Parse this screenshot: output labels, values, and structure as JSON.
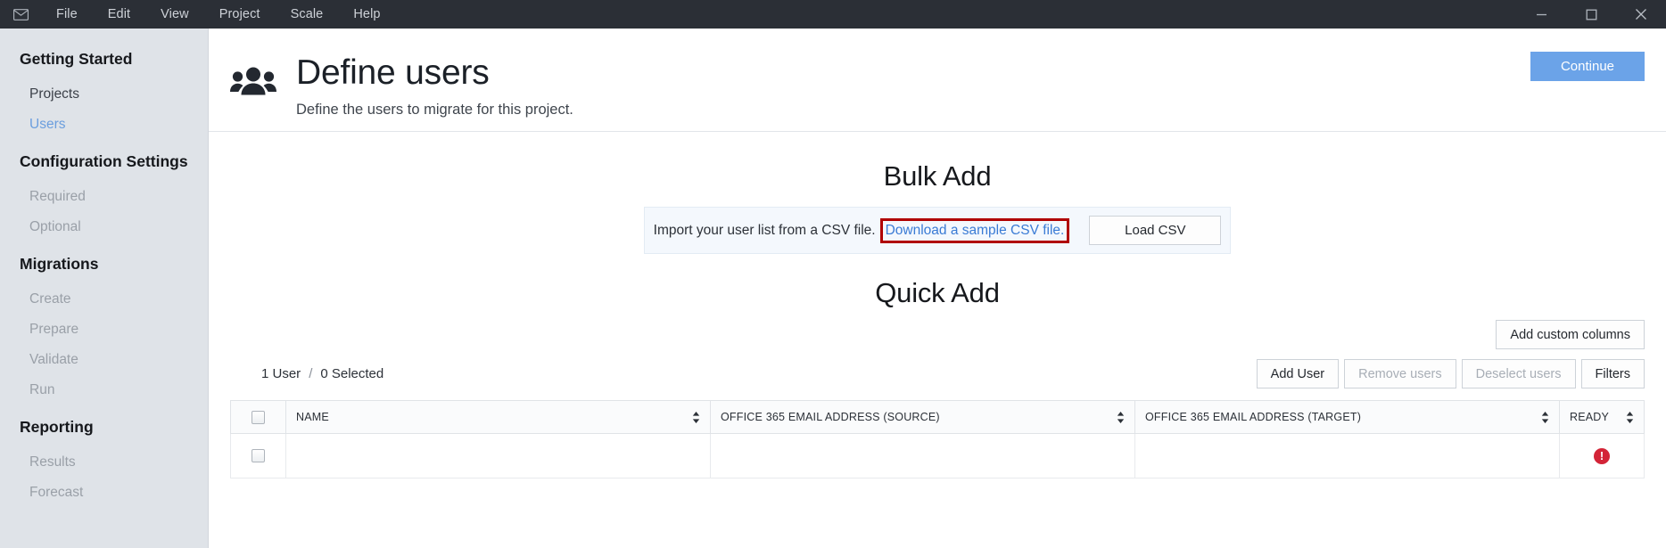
{
  "titlebar": {
    "app_icon": "envelope-icon",
    "menu": [
      {
        "label": "File"
      },
      {
        "label": "Edit"
      },
      {
        "label": "View"
      },
      {
        "label": "Project"
      },
      {
        "label": "Scale"
      },
      {
        "label": "Help"
      }
    ],
    "window_controls": [
      {
        "name": "minimize",
        "icon": "minimize-icon"
      },
      {
        "name": "maximize",
        "icon": "maximize-icon"
      },
      {
        "name": "close",
        "icon": "close-icon"
      }
    ]
  },
  "sidebar": {
    "groups": [
      {
        "title": "Getting Started",
        "items": [
          {
            "label": "Projects",
            "state": "normal"
          },
          {
            "label": "Users",
            "state": "active"
          }
        ]
      },
      {
        "title": "Configuration Settings",
        "items": [
          {
            "label": "Required",
            "state": "disabled"
          },
          {
            "label": "Optional",
            "state": "disabled"
          }
        ]
      },
      {
        "title": "Migrations",
        "items": [
          {
            "label": "Create",
            "state": "disabled"
          },
          {
            "label": "Prepare",
            "state": "disabled"
          },
          {
            "label": "Validate",
            "state": "disabled"
          },
          {
            "label": "Run",
            "state": "disabled"
          }
        ]
      },
      {
        "title": "Reporting",
        "items": [
          {
            "label": "Results",
            "state": "disabled"
          },
          {
            "label": "Forecast",
            "state": "disabled"
          }
        ]
      }
    ]
  },
  "header": {
    "icon": "users-group-icon",
    "title": "Define users",
    "subtitle": "Define the users to migrate for this project.",
    "continue_label": "Continue"
  },
  "bulk_add": {
    "title": "Bulk Add",
    "description": "Import your user list from a CSV file.",
    "link_label": "Download a sample CSV file.",
    "load_button_label": "Load CSV",
    "annotation_color": "#b00000"
  },
  "quick_add": {
    "title": "Quick Add",
    "add_custom_columns_label": "Add custom columns",
    "count_users": "1 User",
    "count_separator": "/",
    "count_selected": "0 Selected",
    "buttons": [
      {
        "label": "Add User",
        "state": "enabled"
      },
      {
        "label": "Remove users",
        "state": "disabled"
      },
      {
        "label": "Deselect users",
        "state": "disabled"
      },
      {
        "label": "Filters",
        "state": "enabled"
      }
    ],
    "table": {
      "columns": [
        {
          "label": "",
          "type": "checkbox"
        },
        {
          "label": "NAME",
          "sortable": true
        },
        {
          "label": "OFFICE 365 EMAIL ADDRESS (SOURCE)",
          "sortable": true
        },
        {
          "label": "OFFICE 365 EMAIL ADDRESS (TARGET)",
          "sortable": true
        },
        {
          "label": "READY",
          "sortable": true
        }
      ],
      "rows": [
        {
          "selected": false,
          "name": "",
          "source_email": "",
          "target_email": "",
          "ready_status": "error",
          "ready_icon": "error-exclamation-icon"
        }
      ]
    }
  },
  "colors": {
    "titlebar_bg": "#2b2f36",
    "sidebar_bg": "#dfe3e8",
    "accent_blue": "#6ba3e8",
    "link_blue": "#3a7bd5",
    "annotation_red": "#b00000",
    "error_red": "#d32437"
  }
}
